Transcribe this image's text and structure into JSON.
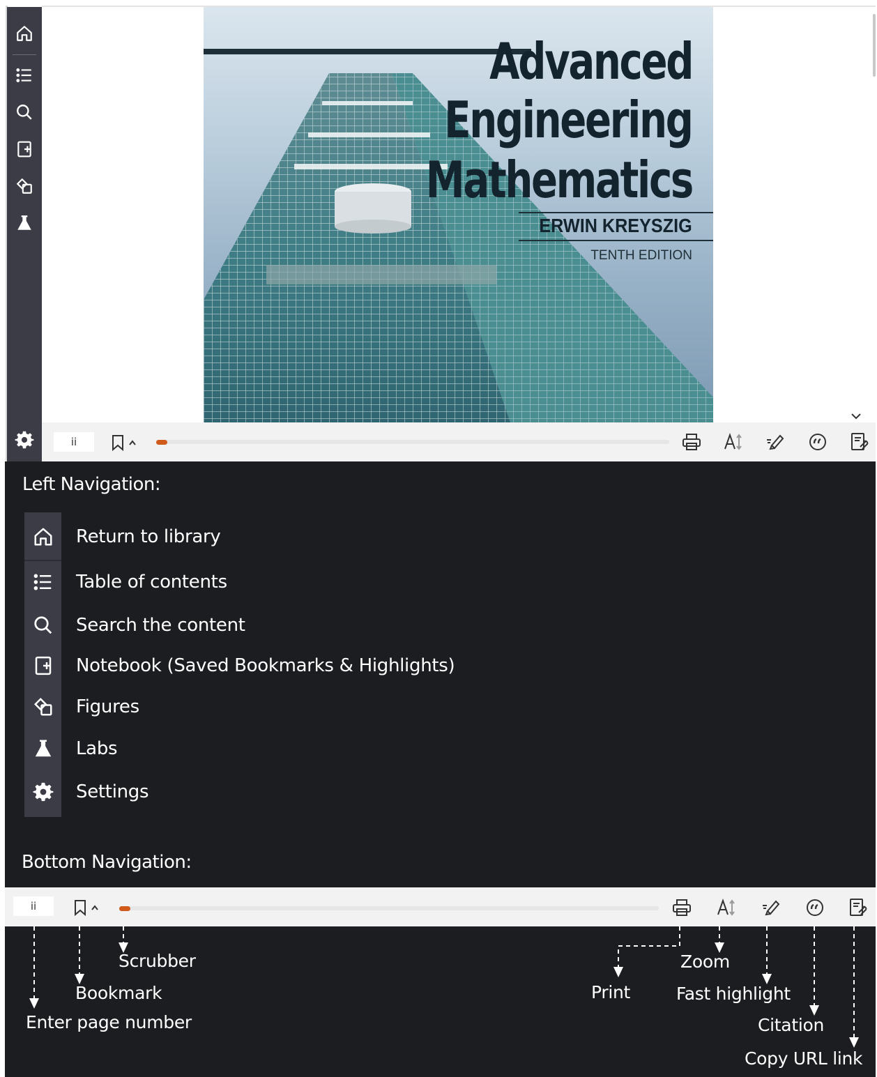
{
  "reader": {
    "sidebar_items": [
      "home-icon",
      "list-icon",
      "search-icon",
      "notebook-icon",
      "figures-icon",
      "labs-icon"
    ],
    "settings_icon": "gear-icon",
    "page_input_value": "ii",
    "colors": {
      "sidebar": "#3b3c46",
      "scrubber_knob": "#cf5a1a",
      "bar": "#f2f2f2"
    }
  },
  "cover": {
    "title_line1": "Advanced",
    "title_line2": "Engineering",
    "title_line3": "Mathematics",
    "author": "ERWIN KREYSZIG",
    "edition": "TENTH EDITION"
  },
  "legend": {
    "left_nav_title": "Left Navigation:",
    "left_nav_items": [
      {
        "icon": "home-icon",
        "label": "Return to library"
      },
      {
        "icon": "list-icon",
        "label": "Table of contents"
      },
      {
        "icon": "search-icon",
        "label": "Search the content"
      },
      {
        "icon": "notebook-icon",
        "label": "Notebook (Saved Bookmarks & Highlights)"
      },
      {
        "icon": "figures-icon",
        "label": "Figures"
      },
      {
        "icon": "labs-icon",
        "label": "Labs"
      },
      {
        "icon": "gear-icon",
        "label": "Settings"
      }
    ],
    "bottom_nav_title": "Bottom Navigation:",
    "bottom_bar": {
      "page_input_value": "ii"
    },
    "annotations": {
      "scrubber": "Scrubber",
      "bookmark": "Bookmark",
      "enter_page": "Enter page number",
      "print": "Print",
      "zoom": "Zoom",
      "fast_highlight": "Fast highlight",
      "citation": "Citation",
      "copy_url": "Copy URL link"
    }
  }
}
